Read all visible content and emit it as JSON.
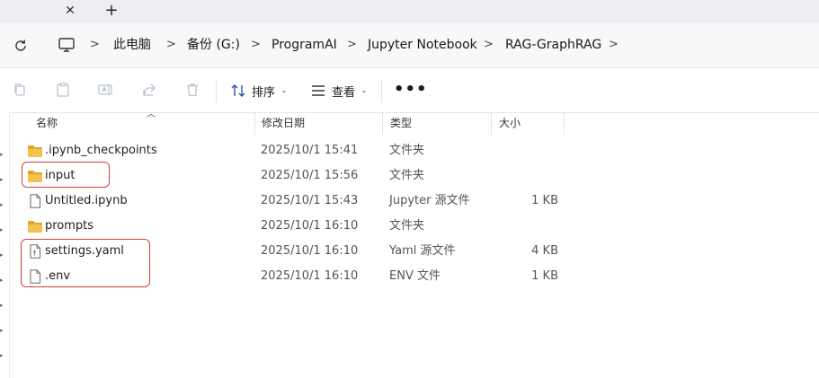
{
  "tabbar": {
    "close_icon": "close-icon",
    "new_tab_icon": "plus-icon"
  },
  "breadcrumb": [
    "此电脑",
    "备份 (G:)",
    "ProgramAI",
    "Jupyter Notebook",
    "RAG-GraphRAG"
  ],
  "commands": {
    "sort_label": "排序",
    "view_label": "查看",
    "more_label": "•••"
  },
  "columns": {
    "name": "名称",
    "modified": "修改日期",
    "type": "类型",
    "size": "大小"
  },
  "files": [
    {
      "name": ".ipynb_checkpoints",
      "modified": "2025/10/1 15:41",
      "type": "文件夹",
      "size": "",
      "icon": "folder-icon"
    },
    {
      "name": "input",
      "modified": "2025/10/1 15:56",
      "type": "文件夹",
      "size": "",
      "icon": "folder-icon"
    },
    {
      "name": "Untitled.ipynb",
      "modified": "2025/10/1 15:43",
      "type": "Jupyter 源文件",
      "size": "1 KB",
      "icon": "file-icon"
    },
    {
      "name": "prompts",
      "modified": "2025/10/1 16:10",
      "type": "文件夹",
      "size": "",
      "icon": "folder-icon"
    },
    {
      "name": "settings.yaml",
      "modified": "2025/10/1 16:10",
      "type": "Yaml 源文件",
      "size": "4 KB",
      "icon": "config-file-icon"
    },
    {
      "name": ".env",
      "modified": "2025/10/1 16:10",
      "type": "ENV 文件",
      "size": "1 KB",
      "icon": "file-icon"
    }
  ],
  "colors": {
    "highlight": "#d1413a",
    "folder": "#f3c14d",
    "folder_dark": "#e0a526"
  }
}
